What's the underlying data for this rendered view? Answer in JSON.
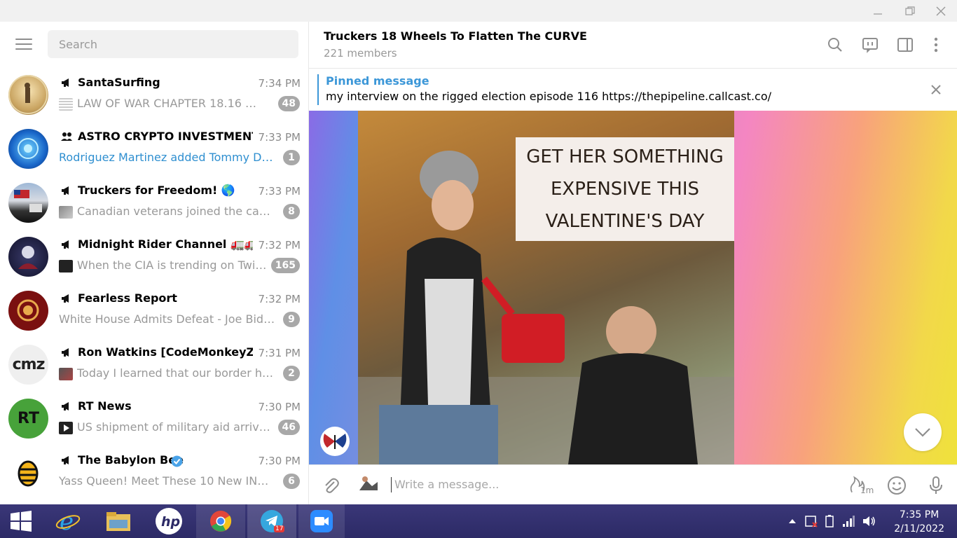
{
  "window": {
    "controls": [
      "minimize",
      "restore",
      "close"
    ]
  },
  "sidebar": {
    "search_placeholder": "Search",
    "chats": [
      {
        "name": "SantaSurfing",
        "type": "channel",
        "time": "7:34 PM",
        "preview": "LAW OF WAR CHAPTER 18.16  CO...",
        "badge": "48",
        "preview_color": "gray"
      },
      {
        "name": "ASTRO CRYPTO INVESTMENT...",
        "type": "group",
        "time": "7:33 PM",
        "preview": "Rodriguez Martinez added Tommy DeVi...",
        "badge": "1",
        "preview_color": "blue"
      },
      {
        "name": "Truckers for Freedom! 🌎",
        "type": "channel",
        "time": "7:33 PM",
        "preview": "Canadian veterans joined the cause ...",
        "badge": "8",
        "preview_color": "gray"
      },
      {
        "name": "Midnight Rider Channel 🚛🚛...",
        "type": "channel",
        "time": "7:32 PM",
        "preview": "When the CIA is trending on Twitte...",
        "badge": "165",
        "preview_color": "gray"
      },
      {
        "name": "Fearless Report",
        "type": "channel",
        "time": "7:32 PM",
        "preview": "White House Admits Defeat - Joe Biden i...",
        "badge": "9",
        "preview_color": "gray"
      },
      {
        "name": "Ron Watkins [CodeMonkeyZ]",
        "type": "channel",
        "time": "7:31 PM",
        "preview": "Today I learned that our border has ...",
        "badge": "2",
        "preview_color": "gray"
      },
      {
        "name": "RT News",
        "type": "channel",
        "time": "7:30 PM",
        "preview": "US shipment of military aid arrives i...",
        "badge": "46",
        "preview_color": "gray"
      },
      {
        "name": "The Babylon Bee",
        "type": "channel",
        "time": "7:30 PM",
        "preview": "Yass Queen! Meet These 10 New INCLUS...",
        "badge": "6",
        "preview_color": "gray"
      }
    ],
    "avatar_texts": {
      "cmz": "cmz",
      "rt": "RT"
    }
  },
  "header": {
    "title": "Truckers 18 Wheels To Flatten The CURVE",
    "subtitle": "221 members"
  },
  "pinned": {
    "label": "Pinned message",
    "text": "my interview on the rigged election  episode 116  https://thepipeline.callcast.co/"
  },
  "media": {
    "promo_lines": [
      "GET HER SOMETHING",
      "EXPENSIVE THIS",
      "VALENTINE'S DAY"
    ]
  },
  "composer": {
    "placeholder": "Write a message...",
    "timer_label": "1m"
  },
  "taskbar": {
    "telegram_badge": "17",
    "clock_time": "7:35 PM",
    "clock_date": "2/11/2022"
  },
  "colors": {
    "accent": "#3c97d8",
    "badge": "#a8a8a8",
    "taskbar": "#2c2a66"
  }
}
